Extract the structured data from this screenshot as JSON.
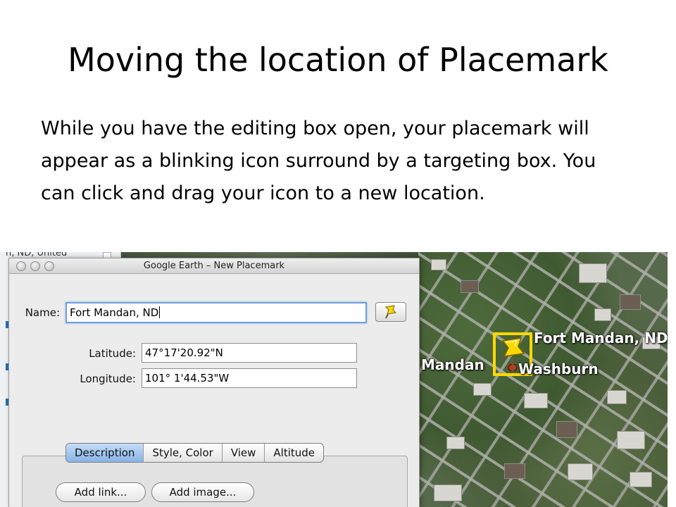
{
  "slide": {
    "title": "Moving the location of Placemark",
    "body": "While you have the editing box open, your placemark will appear as a blinking icon surround by a targeting box. You can click and drag your icon to a new location."
  },
  "sidebar": {
    "partial_text": "n, ND, United"
  },
  "dialog": {
    "title": "Google Earth – New Placemark",
    "name_label": "Name:",
    "name_value": "Fort Mandan, ND",
    "latitude_label": "Latitude:",
    "latitude_value": "47°17'20.92\"N",
    "longitude_label": "Longitude:",
    "longitude_value": "101° 1'44.53\"W",
    "icon_button_icon": "pushpin-icon",
    "tabs": [
      {
        "label": "Description",
        "active": true
      },
      {
        "label": "Style, Color",
        "active": false
      },
      {
        "label": "View",
        "active": false
      },
      {
        "label": "Altitude",
        "active": false
      }
    ],
    "add_link_label": "Add link...",
    "add_image_label": "Add image..."
  },
  "map": {
    "labels": {
      "fort_mandan": "Fort Mandan, ND",
      "mandan": "Mandan",
      "washburn": "Washburn"
    },
    "pin_icon": "yellow-pushpin-icon"
  },
  "colors": {
    "target_box": "#ffd800",
    "active_tab": "#86b4e8",
    "focus_ring": "#6f9fd8"
  }
}
